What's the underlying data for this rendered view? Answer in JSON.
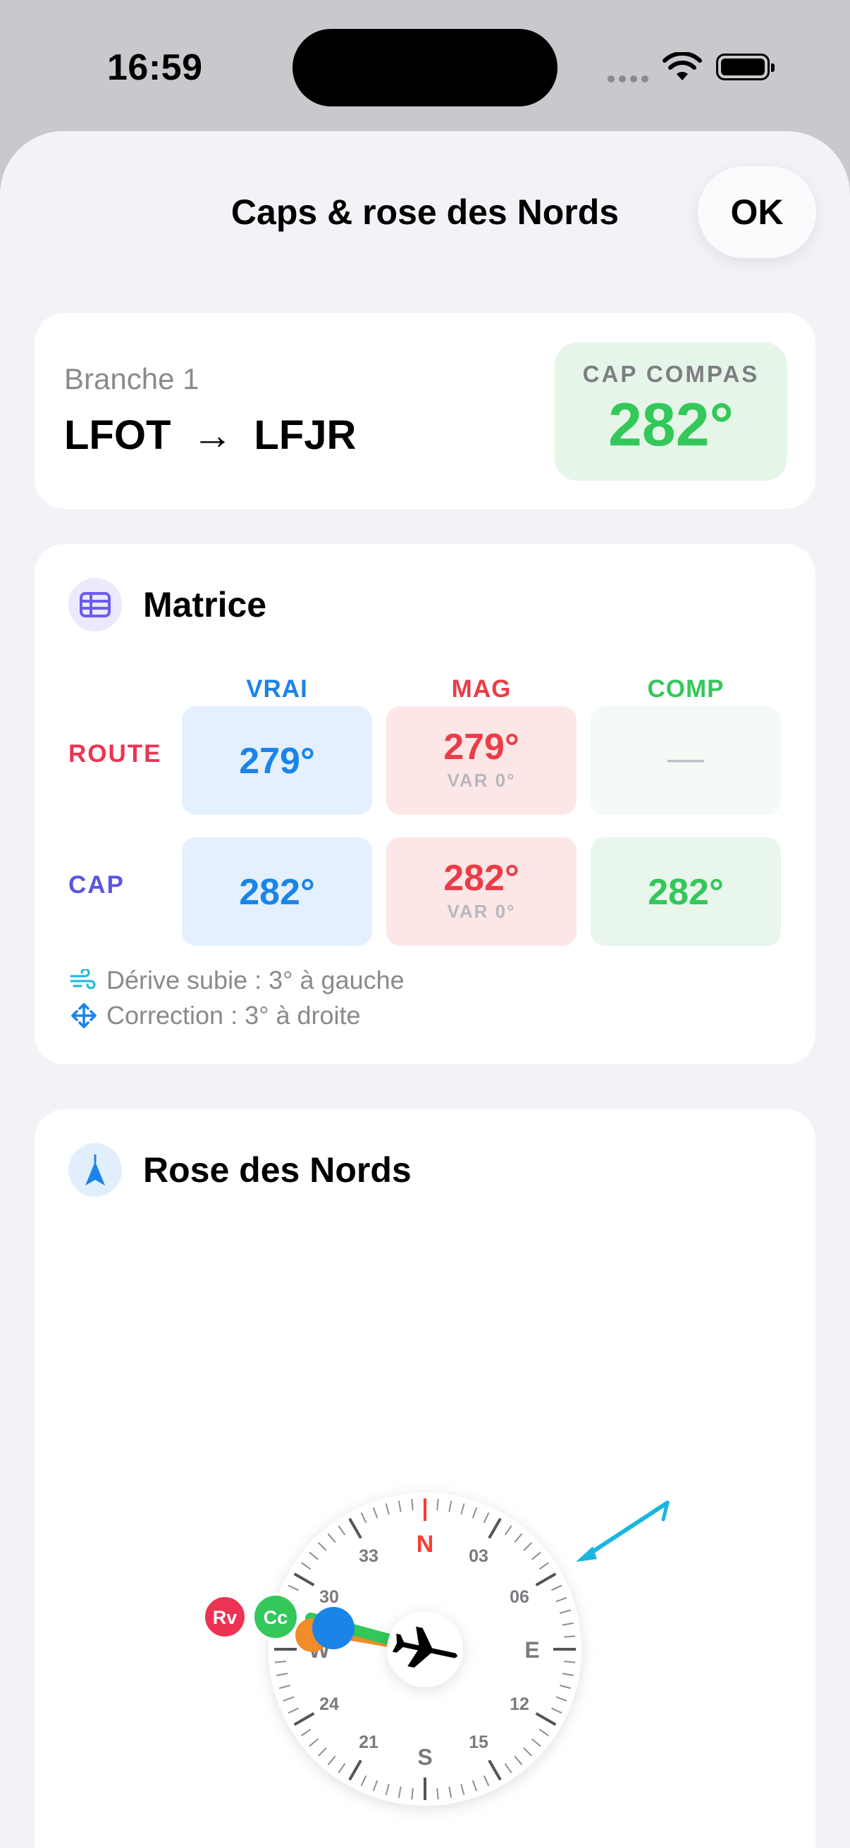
{
  "status_bar": {
    "time": "16:59"
  },
  "sheet": {
    "title": "Caps & rose des Nords",
    "ok_label": "OK"
  },
  "leg": {
    "label": "Branche 1",
    "from": "LFOT",
    "arrow": "→",
    "to": "LFJR",
    "cap_label": "CAP COMPAS",
    "cap_value": "282°"
  },
  "matrix": {
    "title": "Matrice",
    "columns": [
      "VRAI",
      "MAG",
      "COMP"
    ],
    "rows": [
      {
        "label": "ROUTE",
        "vrai": "279°",
        "mag": "279°",
        "mag_sub": "VAR 0°",
        "comp": "—"
      },
      {
        "label": "CAP",
        "vrai": "282°",
        "mag": "282°",
        "mag_sub": "VAR 0°",
        "comp": "282°"
      }
    ],
    "notes": [
      {
        "icon": "wind-icon",
        "text": "Dérive subie : 3° à gauche"
      },
      {
        "icon": "move-arrows-icon",
        "text": "Correction : 3° à droite"
      }
    ]
  },
  "rose": {
    "title": "Rose des Nords",
    "cardinals": {
      "N": "N",
      "E": "E",
      "S": "S",
      "W": "W"
    },
    "ticks": [
      "03",
      "06",
      "12",
      "15",
      "21",
      "24",
      "30",
      "33"
    ],
    "markers": [
      "Rv",
      "Cc"
    ],
    "colors": {
      "north": "#ff3b30",
      "rv": "#ec3353",
      "cc": "#34c759",
      "mag": "#f08c2a",
      "vrai": "#1a84e8",
      "wind": "#19b6e0"
    }
  }
}
